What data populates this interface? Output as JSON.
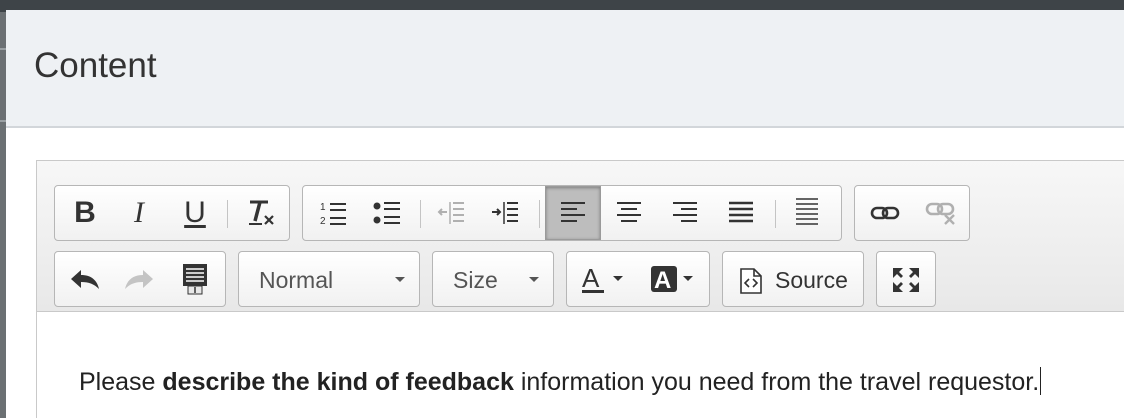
{
  "modal": {
    "title": "Content"
  },
  "toolbar": {
    "row1": {
      "bold": "bold-icon",
      "italic": "italic-icon",
      "underline": "underline-icon",
      "remove_format": "remove-format-icon",
      "numbered_list": "numbered-list-icon",
      "bulleted_list": "bulleted-list-icon",
      "outdent": "outdent-icon",
      "indent": "indent-icon",
      "align_left": "align-left-icon",
      "align_center": "align-center-icon",
      "align_right": "align-right-icon",
      "justify": "justify-icon",
      "block_justify": "horizontal-lines-icon",
      "link": "link-icon",
      "unlink": "unlink-icon"
    },
    "format_select": {
      "value": "Normal"
    },
    "size_select": {
      "value": "Size"
    },
    "source_label": "Source",
    "glyphs": {
      "bold": "B",
      "italic": "I",
      "underline": "U",
      "text_color": "A",
      "bg_color": "A"
    }
  },
  "editor_content": {
    "before": "Please ",
    "bold": "describe the kind of feedback",
    "after": " information you need from the travel requestor."
  },
  "colors": {
    "active_button": "#bdbdbd",
    "header_bg": "#eef1f4",
    "toolbar_bg": "#eeeeee"
  }
}
